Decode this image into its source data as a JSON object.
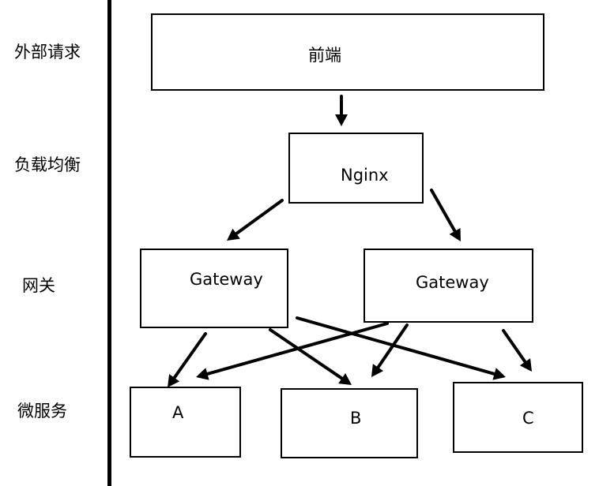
{
  "layers": {
    "request": "外部请求",
    "load_balance": "负载均衡",
    "gateway": "网关",
    "microservice": "微服务"
  },
  "nodes": {
    "frontend": "前端",
    "nginx": "Nginx",
    "gateway_1": "Gateway",
    "gateway_2": "Gateway",
    "service_a": "A",
    "service_b": "B",
    "service_c": "C"
  },
  "edges": [
    {
      "from": "frontend",
      "to": "nginx"
    },
    {
      "from": "nginx",
      "to": "gateway_1"
    },
    {
      "from": "nginx",
      "to": "gateway_2"
    },
    {
      "from": "gateway_1",
      "to": "service_a"
    },
    {
      "from": "gateway_1",
      "to": "service_b"
    },
    {
      "from": "gateway_1",
      "to": "service_c"
    },
    {
      "from": "gateway_2",
      "to": "service_a"
    },
    {
      "from": "gateway_2",
      "to": "service_b"
    },
    {
      "from": "gateway_2",
      "to": "service_c"
    }
  ],
  "colors": {
    "stroke": "#000000",
    "background": "#ffffff"
  }
}
